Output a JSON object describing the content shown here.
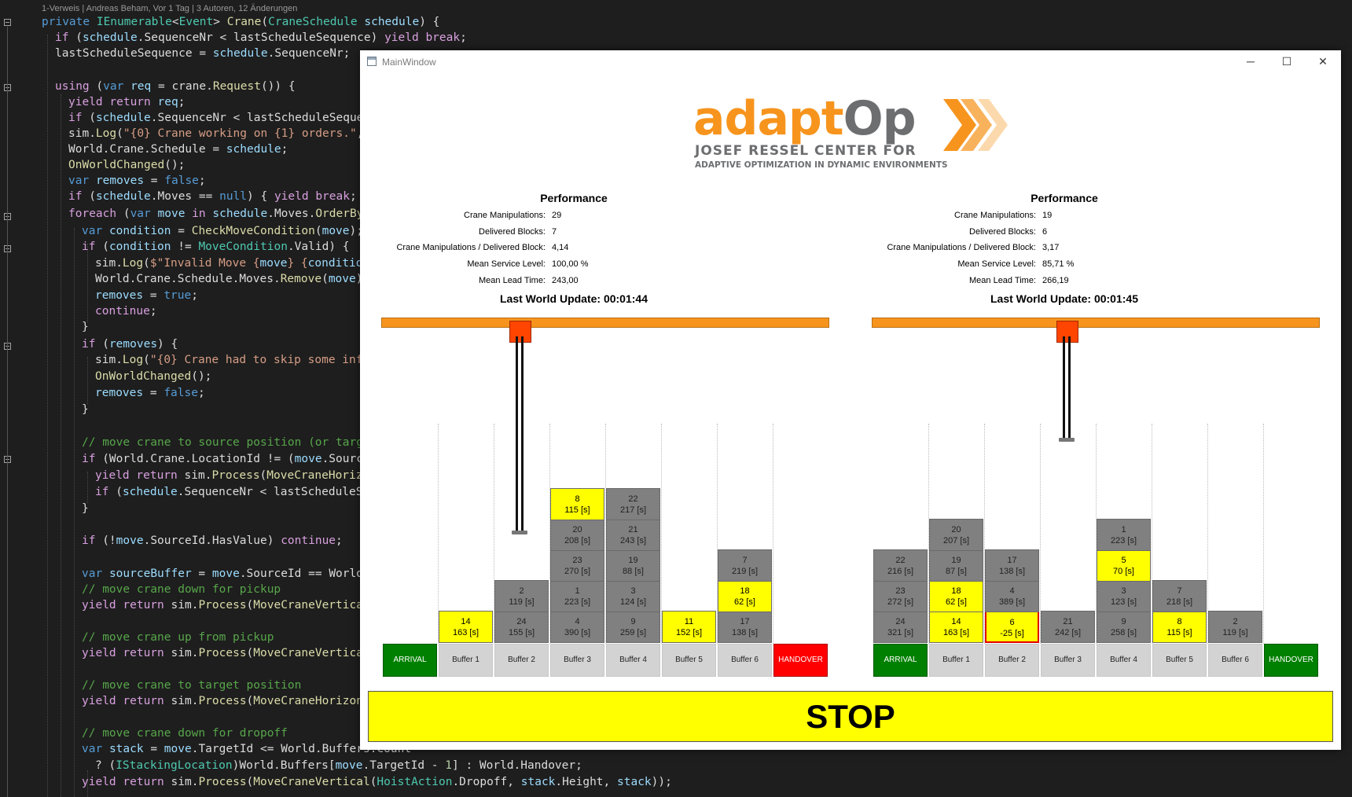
{
  "editor": {
    "codelens": "1-Verweis | Andreas Beham, Vor 1 Tag | 3 Autoren, 12 Änderungen"
  },
  "window": {
    "title": "MainWindow",
    "minimize": "─",
    "maximize": "☐",
    "close": "✕"
  },
  "logo": {
    "main_a": "adapt",
    "main_b": "Op",
    "sub1": "JOSEF RESSEL CENTER FOR",
    "sub2": "ADAPTIVE OPTIMIZATION IN DYNAMIC ENVIRONMENTS"
  },
  "left_panel": {
    "title": "Performance",
    "metrics": [
      {
        "label": "Crane Manipulations:",
        "value": "29"
      },
      {
        "label": "Delivered Blocks:",
        "value": "7"
      },
      {
        "label": "Crane Manipulations / Delivered Block:",
        "value": "4,14"
      },
      {
        "label": "Mean Service Level:",
        "value": "100,00 %"
      },
      {
        "label": "Mean Lead Time:",
        "value": "243,00"
      }
    ],
    "last_update": "Last World Update: 00:01:44",
    "locations": [
      "ARRIVAL",
      "Buffer 1",
      "Buffer 2",
      "Buffer 3",
      "Buffer 4",
      "Buffer 5",
      "Buffer 6",
      "HANDOVER"
    ],
    "stacks": [
      [],
      [
        {
          "id": "14",
          "time": "163 [s]",
          "color": "yellow"
        }
      ],
      [
        {
          "id": "24",
          "time": "155 [s]",
          "color": "gray"
        },
        {
          "id": "2",
          "time": "119 [s]",
          "color": "gray"
        }
      ],
      [
        {
          "id": "4",
          "time": "390 [s]",
          "color": "gray"
        },
        {
          "id": "1",
          "time": "223 [s]",
          "color": "gray"
        },
        {
          "id": "23",
          "time": "270 [s]",
          "color": "gray"
        },
        {
          "id": "20",
          "time": "208 [s]",
          "color": "gray"
        },
        {
          "id": "8",
          "time": "115 [s]",
          "color": "yellow"
        }
      ],
      [
        {
          "id": "9",
          "time": "259 [s]",
          "color": "gray"
        },
        {
          "id": "3",
          "time": "124 [s]",
          "color": "gray"
        },
        {
          "id": "19",
          "time": "88 [s]",
          "color": "gray"
        },
        {
          "id": "21",
          "time": "243 [s]",
          "color": "gray"
        },
        {
          "id": "22",
          "time": "217 [s]",
          "color": "gray"
        }
      ],
      [
        {
          "id": "11",
          "time": "152 [s]",
          "color": "yellow"
        }
      ],
      [
        {
          "id": "17",
          "time": "138 [s]",
          "color": "gray"
        },
        {
          "id": "18",
          "time": "62 [s]",
          "color": "yellow"
        },
        {
          "id": "7",
          "time": "219 [s]",
          "color": "gray"
        }
      ],
      []
    ]
  },
  "right_panel": {
    "title": "Performance",
    "metrics": [
      {
        "label": "Crane Manipulations:",
        "value": "19"
      },
      {
        "label": "Delivered Blocks:",
        "value": "6"
      },
      {
        "label": "Crane Manipulations / Delivered Block:",
        "value": "3,17"
      },
      {
        "label": "Mean Service Level:",
        "value": "85,71 %"
      },
      {
        "label": "Mean Lead Time:",
        "value": "266,19"
      }
    ],
    "last_update": "Last World Update: 00:01:45",
    "locations": [
      "ARRIVAL",
      "Buffer 1",
      "Buffer 2",
      "Buffer 3",
      "Buffer 4",
      "Buffer 5",
      "Buffer 6",
      "HANDOVER"
    ],
    "stacks": [
      [
        {
          "id": "24",
          "time": "321 [s]",
          "color": "gray"
        },
        {
          "id": "23",
          "time": "272 [s]",
          "color": "gray"
        },
        {
          "id": "22",
          "time": "216 [s]",
          "color": "gray"
        }
      ],
      [
        {
          "id": "14",
          "time": "163 [s]",
          "color": "yellow"
        },
        {
          "id": "18",
          "time": "62 [s]",
          "color": "yellow"
        },
        {
          "id": "19",
          "time": "87 [s]",
          "color": "gray"
        },
        {
          "id": "20",
          "time": "207 [s]",
          "color": "gray"
        }
      ],
      [
        {
          "id": "6",
          "time": "-25 [s]",
          "color": "yellow",
          "overdue": true
        },
        {
          "id": "4",
          "time": "389 [s]",
          "color": "gray"
        },
        {
          "id": "17",
          "time": "138 [s]",
          "color": "gray"
        }
      ],
      [
        {
          "id": "21",
          "time": "242 [s]",
          "color": "gray"
        }
      ],
      [
        {
          "id": "9",
          "time": "258 [s]",
          "color": "gray"
        },
        {
          "id": "3",
          "time": "123 [s]",
          "color": "gray"
        },
        {
          "id": "5",
          "time": "70 [s]",
          "color": "yellow"
        },
        {
          "id": "1",
          "time": "223 [s]",
          "color": "gray"
        }
      ],
      [
        {
          "id": "8",
          "time": "115 [s]",
          "color": "yellow"
        },
        {
          "id": "7",
          "time": "218 [s]",
          "color": "gray"
        }
      ],
      [
        {
          "id": "2",
          "time": "119 [s]",
          "color": "gray"
        }
      ],
      []
    ]
  },
  "stop_label": "STOP",
  "colors": {
    "orange": "#f7941d",
    "trolley": "#ff4500",
    "arrival": "#008000",
    "handover_left": "#ff0000",
    "handover_right": "#008000",
    "yellow": "#ffff00",
    "gray": "#808080"
  }
}
